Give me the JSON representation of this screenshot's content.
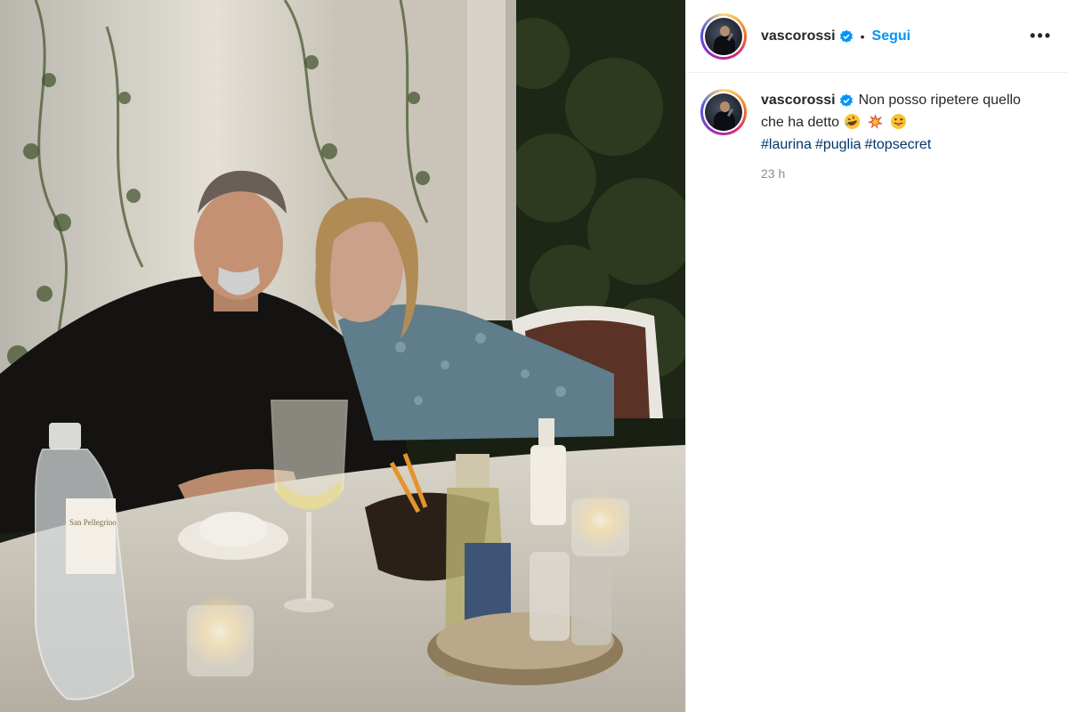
{
  "post": {
    "author": {
      "username": "vascorossi",
      "verified": true,
      "follow_label": "Segui",
      "separator": "•",
      "more_label": "•••"
    },
    "caption": {
      "username": "vascorossi",
      "line1": "Non posso ripetere quello",
      "line2": "che ha detto",
      "emojis": [
        "rolling-on-floor-laughing-emoji",
        "collision-emoji",
        "face-with-tongue-emoji"
      ],
      "hashtags": [
        "#laurina",
        "#puglia",
        "#topsecret"
      ],
      "time": "23 h"
    },
    "photo": {
      "description_icon": "photo-dinner-table",
      "bottle_label": "San Pellegrino"
    }
  },
  "colors": {
    "accent": "#0095f6",
    "hashtag": "#00376b",
    "muted": "#8e8e8e",
    "text": "#262626"
  }
}
